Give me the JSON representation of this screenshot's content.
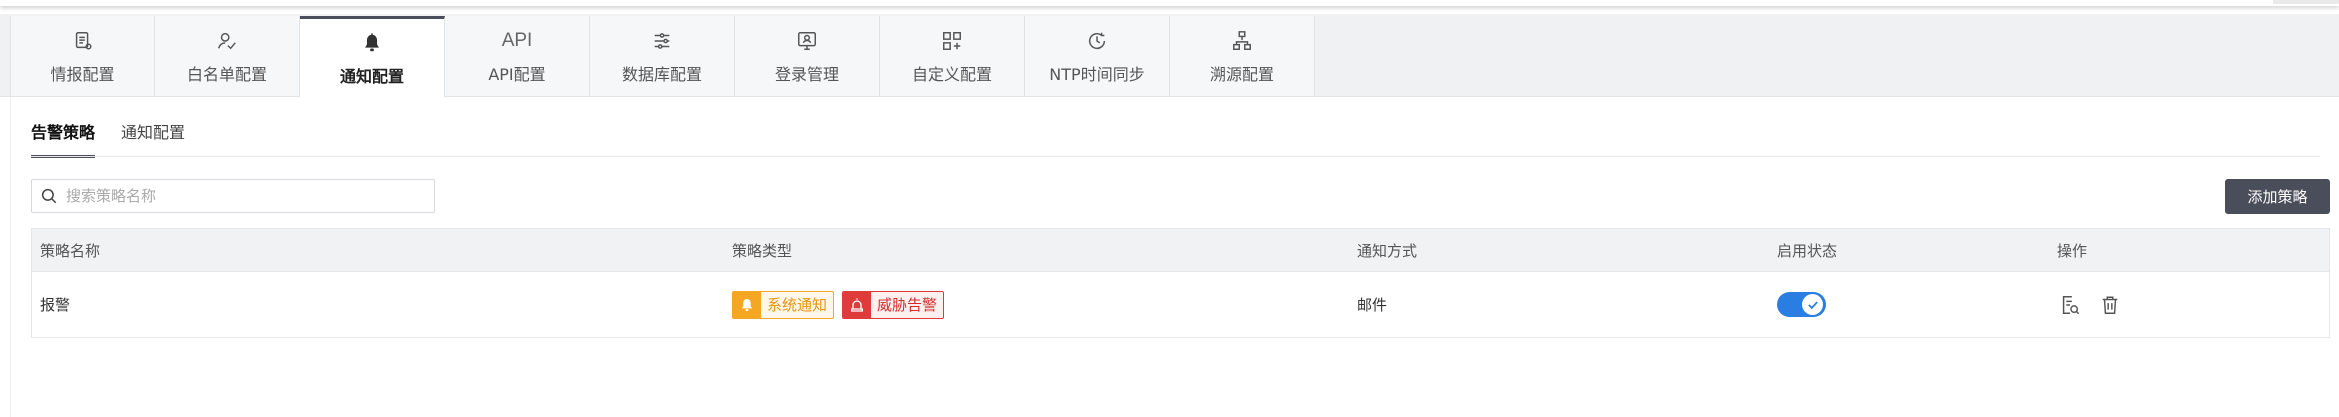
{
  "tabs": [
    {
      "label": "情报配置",
      "icon": "document-icon"
    },
    {
      "label": "白名单配置",
      "icon": "user-check-icon"
    },
    {
      "label": "通知配置",
      "icon": "bell-icon"
    },
    {
      "label": "API配置",
      "icon_text": "API"
    },
    {
      "label": "数据库配置",
      "icon": "database-settings-icon"
    },
    {
      "label": "登录管理",
      "icon": "login-monitor-icon"
    },
    {
      "label": "自定义配置",
      "icon": "custom-grid-icon"
    },
    {
      "label": "NTP时间同步",
      "icon": "clock-sync-icon"
    },
    {
      "label": "溯源配置",
      "icon": "network-tree-icon"
    }
  ],
  "active_tab": "通知配置",
  "subtabs": [
    {
      "label": "告警策略"
    },
    {
      "label": "通知配置"
    }
  ],
  "active_subtab": "告警策略",
  "search": {
    "placeholder": "搜索策略名称",
    "value": ""
  },
  "add_button": "添加策略",
  "table": {
    "columns": [
      "策略名称",
      "策略类型",
      "通知方式",
      "启用状态",
      "操作"
    ],
    "rows": [
      {
        "name": "报警",
        "types": [
          "系统通知",
          "威胁告警"
        ],
        "notify_method": "邮件",
        "enabled": true
      }
    ]
  },
  "colors": {
    "accent": "#4a4d5a",
    "toggle_on": "#2a7de1",
    "system_tag": "#f5a623",
    "threat_tag": "#e03b3b"
  }
}
